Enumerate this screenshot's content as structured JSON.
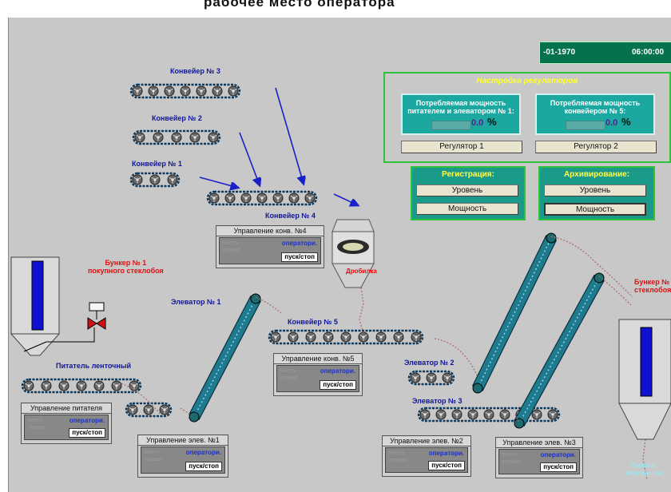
{
  "header": {
    "title": "рабочее место оператора"
  },
  "clock": {
    "date": "-01-1970",
    "time": "06:00:00"
  },
  "regulators": {
    "title": "Настройка регуляторов",
    "left": {
      "line1": "Потребляемая мощность",
      "line2": "питателем и элеватором № 1:",
      "value": "0.0",
      "unit": "%",
      "button": "Регулятор 1"
    },
    "right": {
      "line1": "Потребляемая мощность",
      "line2": "конвейером  № 5:",
      "value": "0.0",
      "unit": "%",
      "button": "Регулятор 2"
    }
  },
  "registration": {
    "title": "Регистрация:",
    "level": "Уровень",
    "power": "Мощность"
  },
  "archiving": {
    "title": "Архивирование:",
    "level": "Уровень",
    "power": "Мощность"
  },
  "labels": {
    "conveyor3": "Конвейер № 3",
    "conveyor2": "Конвейер № 2",
    "conveyor1": "Конвейер № 1",
    "conveyor4": "Конвейер № 4",
    "conveyor5": "Конвейер № 5",
    "elevator1": "Элеватор № 1",
    "elevator2": "Элеватор № 2",
    "elevator3": "Элеватор № 3",
    "feeder": "Питатель ленточный",
    "bunker1_a": "Бункер № 1",
    "bunker1_b": "покупного стеклобоя",
    "bunker2_a": "Бункер №",
    "bunker2_b": "стеклобоя",
    "crusher": "Дробилка",
    "output_a": "Сырье в",
    "output_b": "питатели печ"
  },
  "controls": {
    "conv4": {
      "title": "Управление конв. №4",
      "ghost1": "местн.",
      "ghost2": "управл.",
      "op": "оператори.",
      "button": "пуск/стоп"
    },
    "conv5": {
      "title": "Управление конв. №5",
      "ghost1": "местн.",
      "ghost2": "управл.",
      "op": "оператори.",
      "button": "пуск/стоп"
    },
    "feeder": {
      "title": "Управление питателя",
      "ghost1": "местн.",
      "ghost2": "управл.",
      "op": "оператори.",
      "button": "пуск/стоп"
    },
    "elev1": {
      "title": "Управление элев. №1",
      "ghost1": "местн.",
      "ghost2": "управл.",
      "op": "оператори.",
      "button": "пуск/стоп"
    },
    "elev2": {
      "title": "Управление элев. №2",
      "ghost1": "местн.",
      "ghost2": "управл.",
      "op": "оператори.",
      "button": "пуск/стоп"
    },
    "elev3": {
      "title": "Управление элев. №3",
      "ghost1": "местн.",
      "ghost2": "управл.",
      "op": "оператори.",
      "button": "пуск/стоп"
    }
  },
  "colors": {
    "background": "#c8c8c8",
    "belt": "#0c3a5e",
    "wheel": "#686868",
    "elevator": "#1e7a8c",
    "panel_border": "#2ec23a",
    "arrow": "#1a20c8",
    "label_blue": "#10169a",
    "label_red": "#e01010"
  }
}
